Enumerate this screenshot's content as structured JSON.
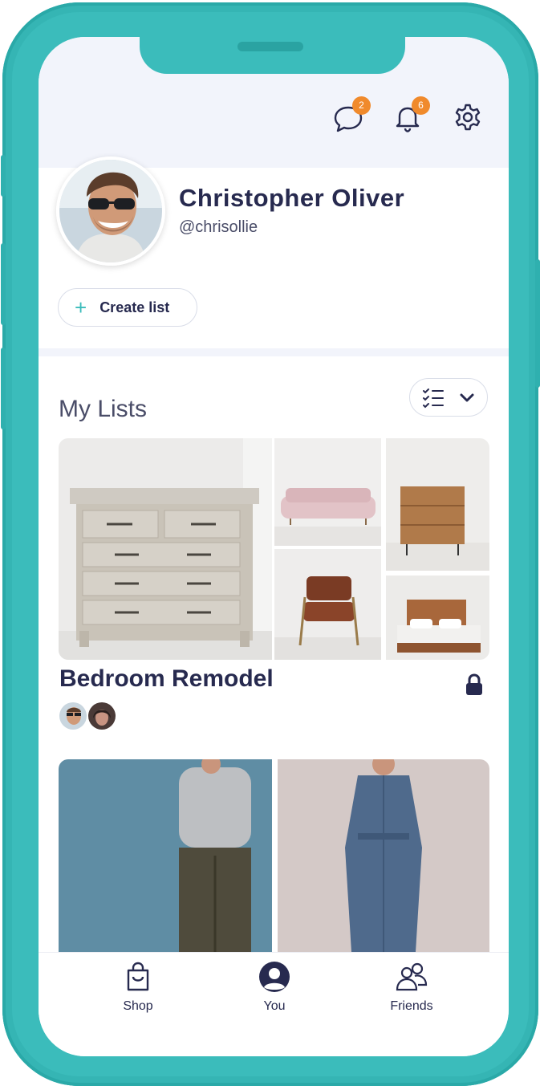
{
  "header": {
    "messages_badge": "2",
    "notifications_badge": "6"
  },
  "profile": {
    "name": "Christopher Oliver",
    "handle": "@chrisollie",
    "create_list_label": "Create list"
  },
  "lists": {
    "section_title": "My Lists",
    "items": [
      {
        "title": "Bedroom Remodel",
        "private": true
      }
    ]
  },
  "tabbar": {
    "items": [
      {
        "label": "Shop",
        "icon": "shopping-bag-icon"
      },
      {
        "label": "You",
        "icon": "user-icon"
      },
      {
        "label": "Friends",
        "icon": "friends-icon"
      }
    ]
  },
  "colors": {
    "frame": "#3bbcbb",
    "badge": "#f08a2c",
    "text_dark": "#272a4f",
    "header_bg": "#f2f4fb"
  }
}
